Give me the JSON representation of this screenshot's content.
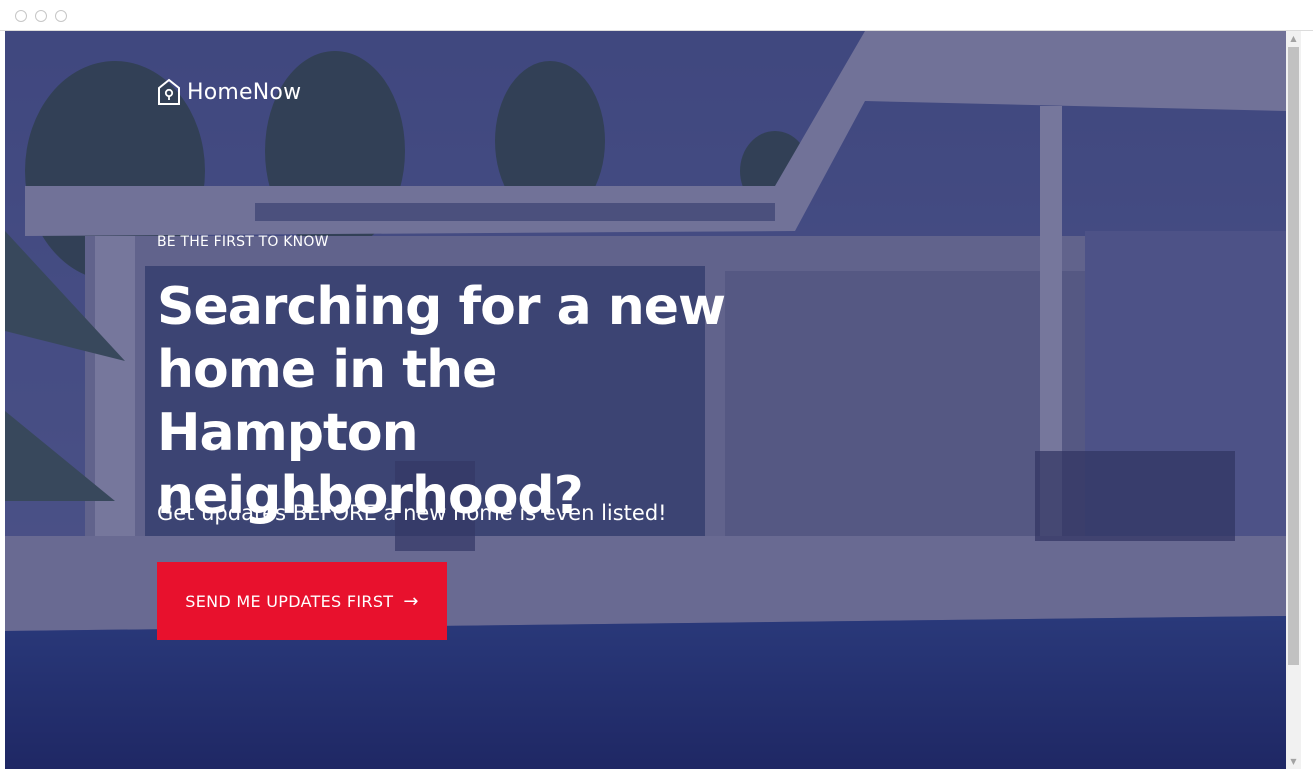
{
  "brand": {
    "name": "HomeNow",
    "icon": "house-icon"
  },
  "hero": {
    "eyebrow": "BE THE FIRST TO KNOW",
    "headline": "Searching for a new home in the Hampton neighborhood?",
    "subtext": "Get updates BEFORE a new home is even listed!",
    "cta_label": "SEND ME UPDATES FIRST",
    "cta_arrow": "→"
  },
  "scrollbar": {
    "up": "▲",
    "down": "▼"
  },
  "colors": {
    "accent": "#e8112d",
    "overlay": "#282c6e",
    "text": "#ffffff"
  }
}
